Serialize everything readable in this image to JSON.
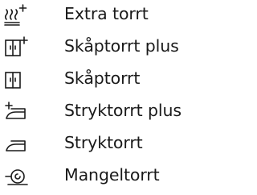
{
  "programs": [
    {
      "label": "Extra torrt",
      "icon": "extra-dry-icon"
    },
    {
      "label": "Skåptorrt plus",
      "icon": "cupboard-dry-plus-icon"
    },
    {
      "label": "Skåptorrt",
      "icon": "cupboard-dry-icon"
    },
    {
      "label": "Stryktorrt plus",
      "icon": "iron-dry-plus-icon"
    },
    {
      "label": "Stryktorrt",
      "icon": "iron-dry-icon"
    },
    {
      "label": "Mangeltorrt",
      "icon": "mangle-dry-icon"
    }
  ],
  "colors": {
    "text": "#1a1a1a",
    "background": "#ffffff"
  }
}
